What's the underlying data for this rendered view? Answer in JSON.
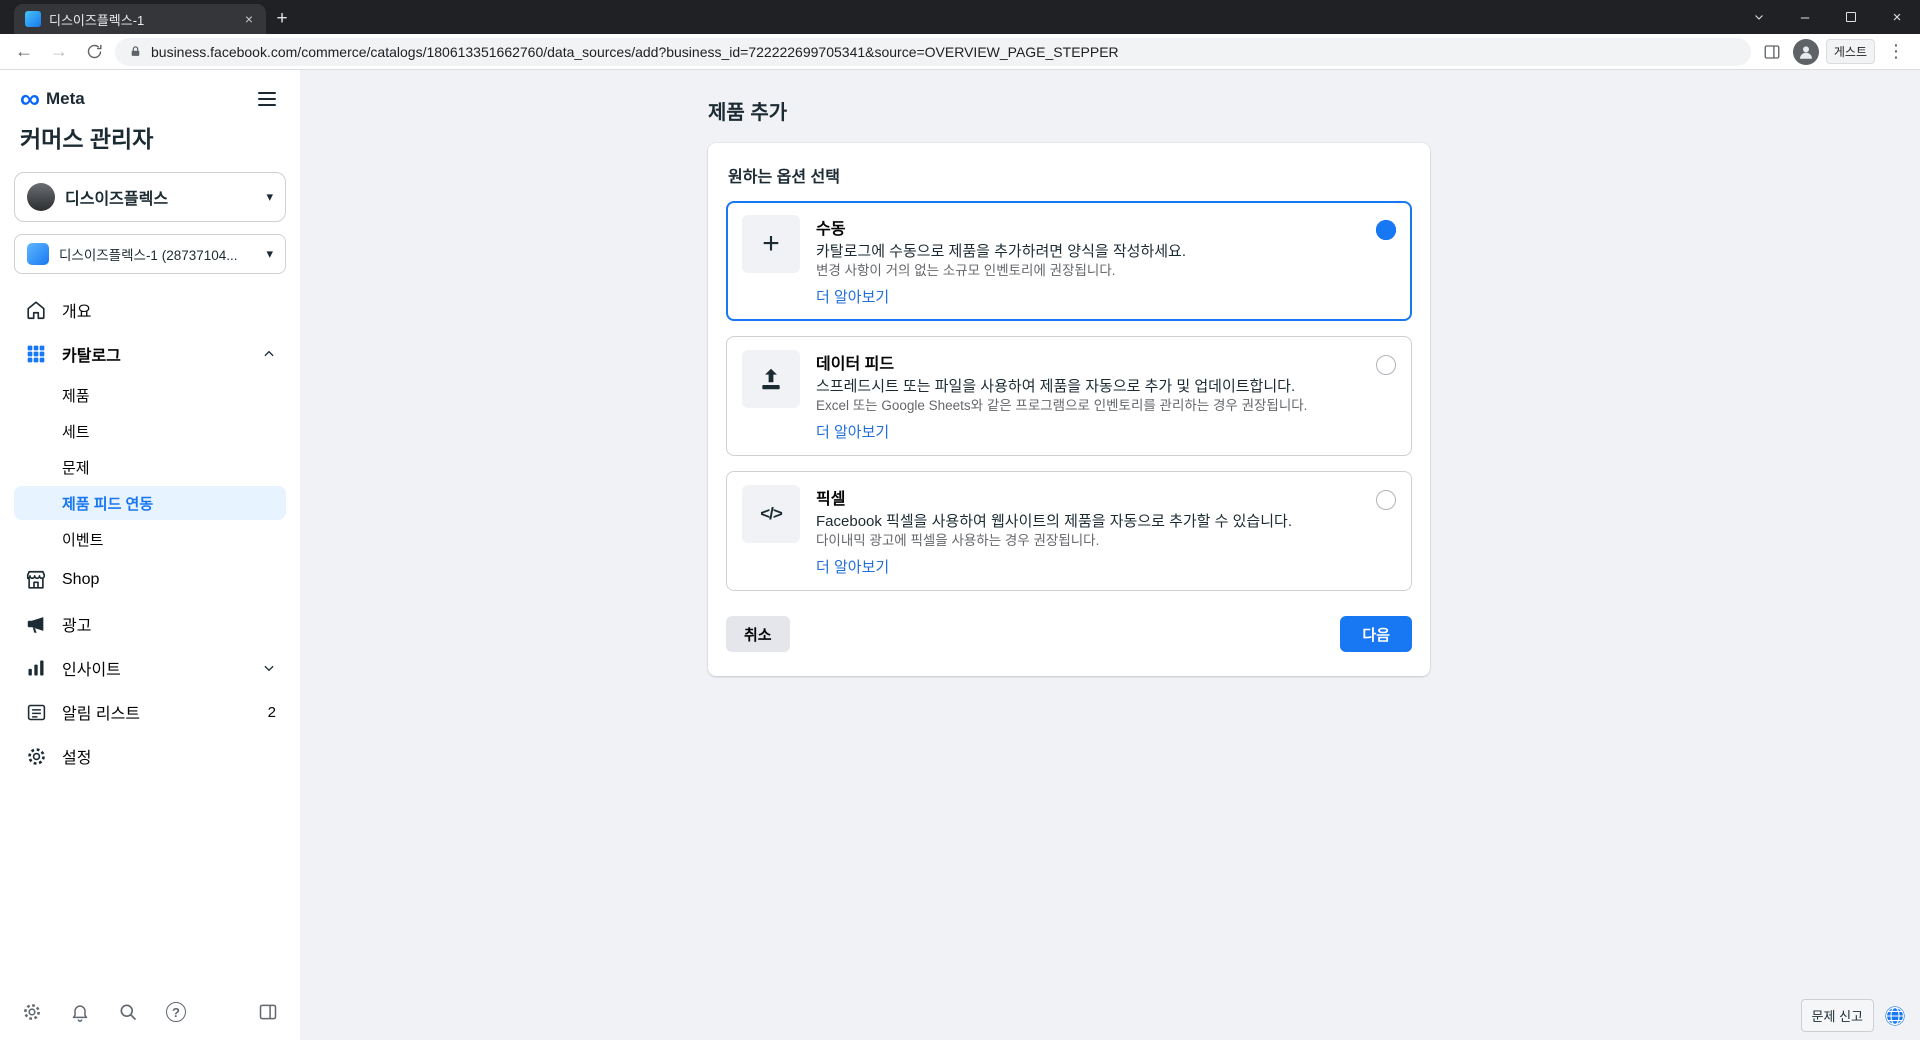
{
  "colors": {
    "accent": "#1877f2",
    "link": "#216fdb",
    "sidebar_active_bg": "#e7f3ff",
    "main_bg": "#f0f2f5",
    "meta_blue": "#0866ff"
  },
  "icons": {
    "infinity": "∞",
    "plus": "+",
    "close": "×",
    "minimize": "–",
    "back": "←",
    "forward": "→",
    "kebab": "⋮",
    "caret_down": "▾",
    "code": "</>",
    "help": "?"
  },
  "browser": {
    "tab_title": "디스이즈플렉스-1",
    "url": "business.facebook.com/commerce/catalogs/180613351662760/data_sources/add?business_id=722222699705341&source=OVERVIEW_PAGE_STEPPER",
    "profile_name": "게스트"
  },
  "sidebar": {
    "brand": "Meta",
    "app_title": "커머스 관리자",
    "business_name": "디스이즈플렉스",
    "catalog_name": "디스이즈플렉스-1 (28737104...",
    "items": [
      {
        "label": "개요"
      },
      {
        "label": "카탈로그"
      },
      {
        "label": "제품"
      },
      {
        "label": "세트"
      },
      {
        "label": "문제"
      },
      {
        "label": "제품 피드 연동"
      },
      {
        "label": "이벤트"
      },
      {
        "label": "Shop"
      },
      {
        "label": "광고"
      },
      {
        "label": "인사이트"
      },
      {
        "label": "알림 리스트",
        "badge": "2"
      },
      {
        "label": "설정"
      }
    ]
  },
  "main": {
    "page_title": "제품 추가",
    "card": {
      "title": "원하는 옵션 선택",
      "options": [
        {
          "title": "수동",
          "description": "카탈로그에 수동으로 제품을 추가하려면 양식을 작성하세요.",
          "note": "변경 사항이 거의 없는 소규모 인벤토리에 권장됩니다.",
          "link": "더 알아보기",
          "selected": true
        },
        {
          "title": "데이터 피드",
          "description": "스프레드시트 또는 파일을 사용하여 제품을 자동으로 추가 및 업데이트합니다.",
          "note": "Excel 또는 Google Sheets와 같은 프로그램으로 인벤토리를 관리하는 경우 권장됩니다.",
          "link": "더 알아보기",
          "selected": false
        },
        {
          "title": "픽셀",
          "description": "Facebook 픽셀을 사용하여 웹사이트의 제품을 자동으로 추가할 수 있습니다.",
          "note": "다이내믹 광고에 픽셀을 사용하는 경우 권장됩니다.",
          "link": "더 알아보기",
          "selected": false
        }
      ],
      "cancel_label": "취소",
      "next_label": "다음"
    },
    "report_button": "문제 신고"
  }
}
